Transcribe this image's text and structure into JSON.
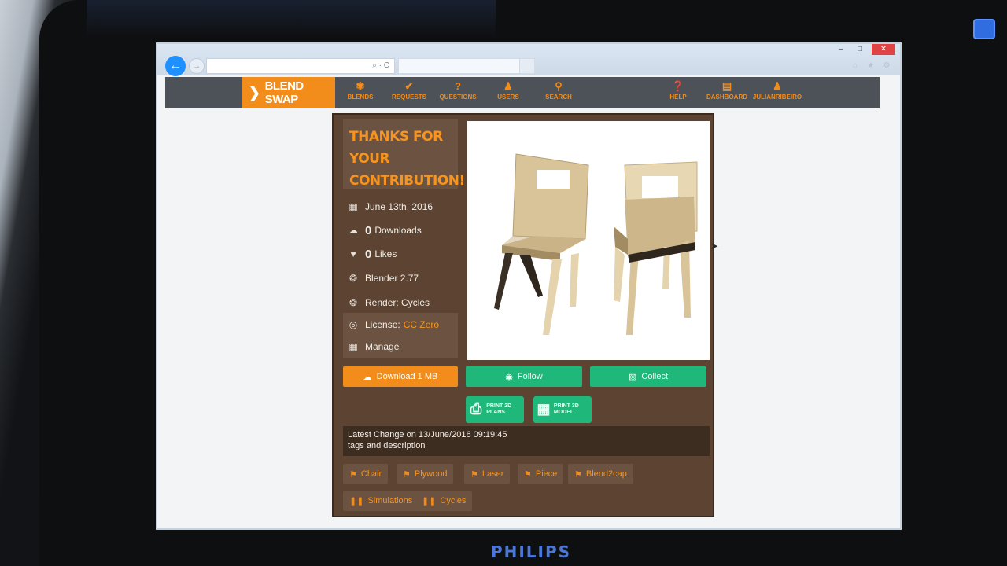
{
  "monitor": {
    "brand": "PHILIPS"
  },
  "browser": {
    "back_icon": "back-arrow-icon",
    "address_controls": "⌕ · C",
    "window_controls": [
      "–",
      "□",
      "✕"
    ]
  },
  "nav": {
    "logo_text": "BLEND SWAP",
    "items": [
      {
        "label": "BLENDS",
        "icon": "blends-icon"
      },
      {
        "label": "REQUESTS",
        "icon": "requests-icon"
      },
      {
        "label": "QUESTIONS",
        "icon": "questions-icon"
      },
      {
        "label": "USERS",
        "icon": "users-icon"
      },
      {
        "label": "SEARCH",
        "icon": "search-icon"
      },
      {
        "label": "HELP",
        "icon": "help-icon"
      },
      {
        "label": "DASHBOARD",
        "icon": "dashboard-icon"
      },
      {
        "label": "JULIANRIBEIRO",
        "icon": "user-icon"
      }
    ]
  },
  "blend": {
    "thanks": "THANKS FOR YOUR CONTRIBUTION!",
    "date": "June 13th, 2016",
    "downloads_count": "0",
    "downloads_label": "Downloads",
    "likes_count": "0",
    "likes_label": "Likes",
    "blender_version": "Blender 2.77",
    "render": "Render: Cycles",
    "license_label": "License:",
    "license_value": "CC Zero",
    "manage": "Manage",
    "download_btn": "Download 1 MB",
    "follow_btn": "Follow",
    "collect_btn": "Collect",
    "print2d_btn": "PRINT 2D PLANS",
    "print3d_btn": "PRINT 3D MODEL",
    "latest_change": "Latest Change on 13/June/2016 09:19:45",
    "change_detail": "tags and description",
    "tags": [
      "Chair",
      "Plywood",
      "Laser",
      "Piece",
      "Blend2cap"
    ],
    "categories": [
      "Simulations",
      "Cycles"
    ]
  },
  "colors": {
    "accent": "#f28c1b",
    "green": "#1fb87a",
    "panel": "#5d4432",
    "nav": "#4c5257"
  }
}
